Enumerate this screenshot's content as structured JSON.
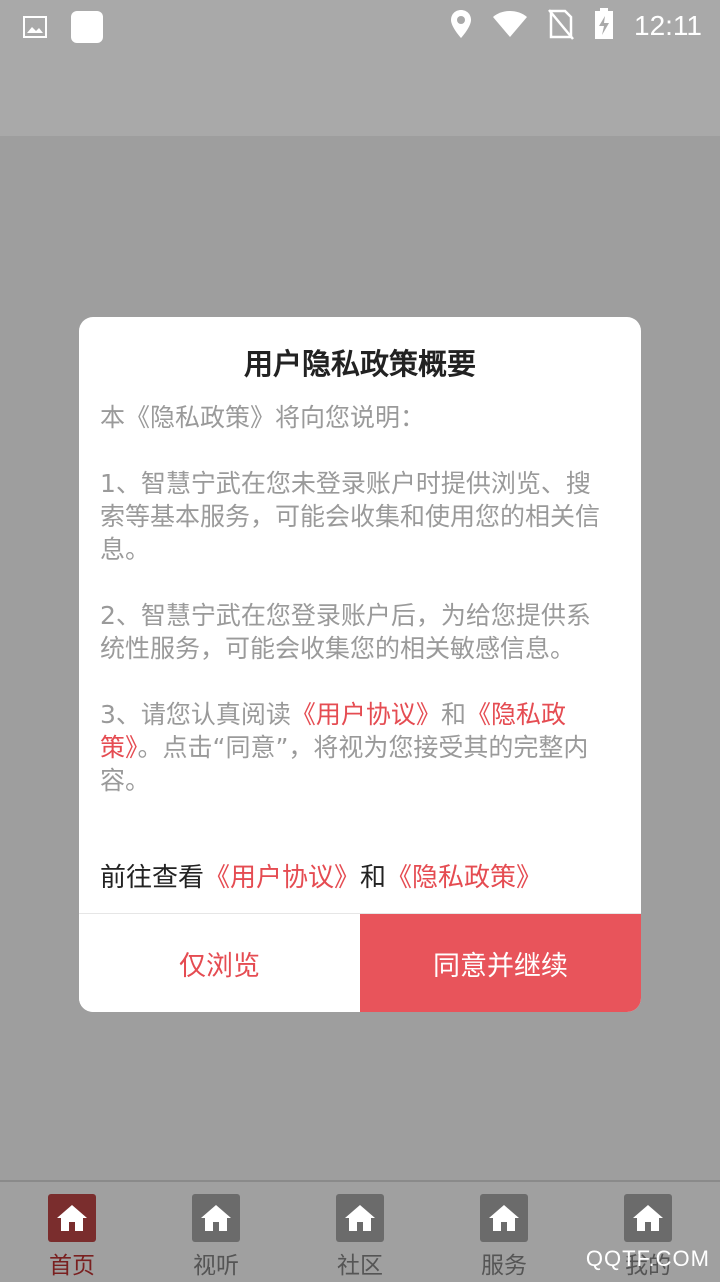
{
  "status_bar": {
    "time": "12:11",
    "icons": [
      "image-icon",
      "app-square-icon",
      "location-icon",
      "wifi-icon",
      "no-sim-icon",
      "battery-charging-icon"
    ]
  },
  "dialog": {
    "title": "用户隐私政策概要",
    "intro": "本《隐私政策》将向您说明：",
    "item1": " 1、智慧宁武在您未登录账户时提供浏览、搜索等基本服务，可能会收集和使用您的相关信息。",
    "item2": " 2、智慧宁武在您登录账户后，为给您提供系统性服务，可能会收集您的相关敏感信息。",
    "item3_pre": " 3、请您认真阅读",
    "item3_link1": "《用户协议》",
    "item3_and": "和",
    "item3_link2": "《隐私政策》",
    "item3_post": "。点击“同意”，将视为您接受其的完整内容。",
    "footer_pre": "前往查看",
    "footer_link1": "《用户协议》",
    "footer_and": "和",
    "footer_link2": "《隐私政策》",
    "btn_browse": "仅浏览",
    "btn_agree": "同意并继续"
  },
  "nav": {
    "items": [
      {
        "label": "首页",
        "icon": "home-icon",
        "active": true
      },
      {
        "label": "视听",
        "icon": "home-icon"
      },
      {
        "label": "社区",
        "icon": "home-icon"
      },
      {
        "label": "服务",
        "icon": "home-icon"
      },
      {
        "label": "我的",
        "icon": "home-icon"
      }
    ]
  },
  "watermark": "QQTF.COM",
  "colors": {
    "accent": "#e8545b",
    "link": "#e54c52",
    "nav_active": "#7a2020"
  }
}
